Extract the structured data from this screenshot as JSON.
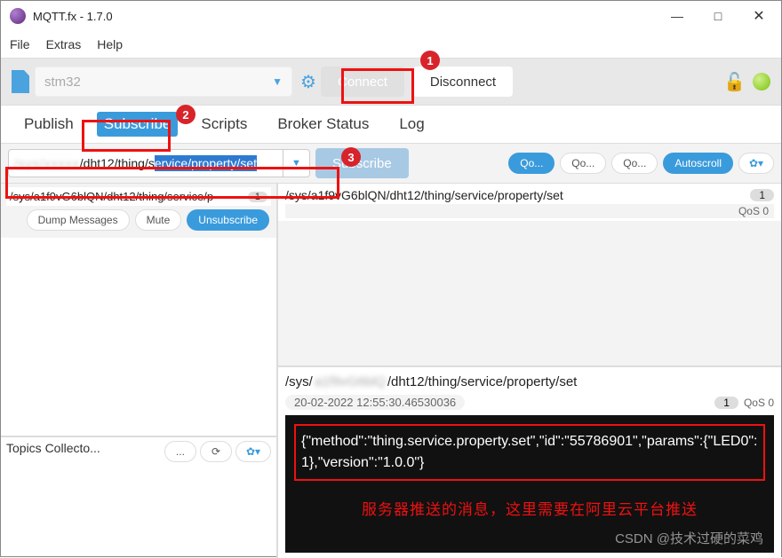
{
  "window": {
    "title": "MQTT.fx - 1.7.0"
  },
  "menu": {
    "file": "File",
    "extras": "Extras",
    "help": "Help"
  },
  "toolbar": {
    "profile": "stm32",
    "connect": "Connect",
    "disconnect": "Disconnect"
  },
  "tabs": {
    "publish": "Publish",
    "subscribe": "Subscribe",
    "scripts": "Scripts",
    "broker_status": "Broker Status",
    "log": "Log"
  },
  "subscribe_row": {
    "topic_prefix_hidden": "/sys/xxxxx",
    "topic_mid": "/dht12/thing/s",
    "topic_selected": "ervice/property/set",
    "subscribe_btn": "Subscribe",
    "qo1": "Qo...",
    "qo2": "Qo...",
    "qo3": "Qo...",
    "autoscroll": "Autoscroll"
  },
  "left": {
    "sub_topic": "/sys/a1f9vG6blQN/dht12/thing/service/p",
    "sub_badge": "1",
    "dump": "Dump Messages",
    "mute": "Mute",
    "unsubscribe": "Unsubscribe",
    "topics_collector": "Topics Collecto...",
    "dots": "..."
  },
  "right_top": {
    "title": "/sys/a1f9vG6blQN/dht12/thing/service/property/set",
    "badge": "1",
    "qos": "QoS 0"
  },
  "right_bot": {
    "title_a": "/sys/",
    "title_blur": "a1f9vG6blQ",
    "title_b": "/dht12/thing/service/property/set",
    "timestamp": "20-02-2022 12:55:30.46530036",
    "badge": "1",
    "qos": "QoS 0",
    "payload_json": "{\"method\":\"thing.service.property.set\",\"id\":\"55786901\",\"params\":{\"LED0\":1},\"version\":\"1.0.0\"}",
    "cn_note": "服务器推送的消息，这里需要在阿里云平台推送",
    "watermark": "CSDN @技术过硬的菜鸡"
  },
  "callouts": {
    "c1": "1",
    "c2": "2",
    "c3": "3"
  }
}
